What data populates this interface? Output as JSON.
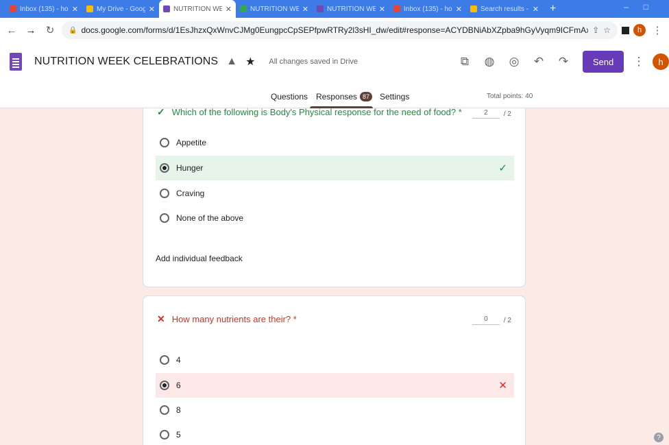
{
  "browser": {
    "tabs": [
      {
        "title": "Inbox (135) - ho",
        "color": "#ea4335"
      },
      {
        "title": "My Drive - Goog",
        "color": "#fbbc04"
      },
      {
        "title": "NUTRITION WEE",
        "color": "#7248b9"
      },
      {
        "title": "NUTRITION WE",
        "color": "#34a853"
      },
      {
        "title": "NUTRITION WE",
        "color": "#7248b9"
      },
      {
        "title": "Inbox (135) - ho",
        "color": "#ea4335"
      },
      {
        "title": "Search results -",
        "color": "#fbbc04"
      }
    ],
    "url": "docs.google.com/forms/d/1EsJhzxQxWnvCJMg0EungpcCpSEPfpwRTRy2l3sHI_dw/edit#response=ACYDBNiAbXZpba9hGyVyqm9ICFmAxtx_ztxZmzC7FTSPg0z-vKQwP-vD...",
    "profile_initial": "h"
  },
  "header": {
    "title": "NUTRITION WEEK CELEBRATIONS",
    "save_status": "All changes saved in Drive",
    "send_label": "Send",
    "avatar_initial": "h"
  },
  "form_tabs": {
    "questions": "Questions",
    "responses": "Responses",
    "responses_count": "87",
    "settings": "Settings",
    "total_points": "Total points: 40"
  },
  "questions": [
    {
      "text": "Which of the following is Body's Physical response for the need of food? *",
      "score": "2",
      "max": "/ 2",
      "options": [
        "Appetite",
        "Hunger",
        "Craving",
        "None of the above"
      ],
      "feedback_label": "Add individual feedback"
    },
    {
      "text": "How many nutrients are their? *",
      "score": "0",
      "max": "/ 2",
      "options": [
        "4",
        "6",
        "8",
        "5"
      ]
    }
  ],
  "colors": {
    "accent": "#673ab7",
    "correct": "#1e8e3e",
    "incorrect": "#d93025",
    "background": "#fbeae6"
  }
}
